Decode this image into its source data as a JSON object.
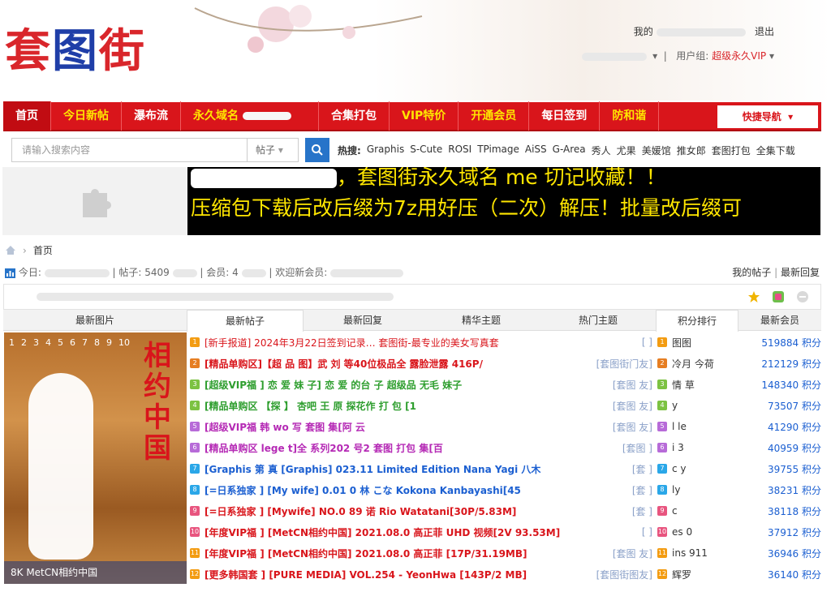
{
  "logo": {
    "c1": "套",
    "c2": "图",
    "c3": "街"
  },
  "user": {
    "my_label": "我的",
    "logout": "退出",
    "group_label": "用户组:",
    "group_value": "超级永久VIP"
  },
  "nav": {
    "items": [
      "首页",
      "今日新帖",
      "瀑布流",
      "永久域名",
      "合集打包",
      "VIP特价",
      "开通会员",
      "每日签到",
      "防和谐"
    ],
    "quick": "快捷导航"
  },
  "search": {
    "placeholder": "请输入搜索内容",
    "type": "帖子"
  },
  "hot": {
    "label": "热搜:",
    "items": [
      "Graphis",
      "S-Cute",
      "ROSI",
      "TPimage",
      "AiSS",
      "G-Area",
      "秀人",
      "尤果",
      "美媛馆",
      "推女郎",
      "套图打包",
      "全集下载"
    ]
  },
  "banner": {
    "line1": "，套图街永久域名  me 切记收藏！！",
    "line2": "压缩包下载后改后缀为7z用好压（二次）解压！批量改后缀可"
  },
  "breadcrumb": {
    "home": "首页"
  },
  "stats": {
    "today": "今日: ",
    "posts": "帖子: 5409",
    "members": "会员: 4",
    "welcome": "欢迎新会员: "
  },
  "stats_right": {
    "my_posts": "我的帖子",
    "sep": "|",
    "newest": "最新回复"
  },
  "tabs": {
    "t1": "最新图片",
    "t2": "最新帖子",
    "t3": "最新回复",
    "t4": "精华主题",
    "t5": "热门主题",
    "t6": "积分排行",
    "t7": "最新会员"
  },
  "image": {
    "pages": [
      "1",
      "2",
      "3",
      "4",
      "5",
      "6",
      "7",
      "8",
      "9",
      "10"
    ],
    "vtitle": "相约中国",
    "caption": "8K MetCN相约中国"
  },
  "threads": [
    {
      "n": "1",
      "title": "[新手报道] 2024年3月22日签到记录… 套图街-最专业的美女写真套",
      "forum": "[        ]",
      "cls": "red"
    },
    {
      "n": "2",
      "title": "[精品单购区]【超 品 图】武 刘 等40位极品全 露脸泄露 416P/",
      "forum": "[套图街门友]",
      "cls": "plain"
    },
    {
      "n": "3",
      "title": "[超级VIP福 ] 恋 爱 妹 子] 恋 爱 的台 子 超级品 无毛 妹子",
      "forum": "[套图 友]",
      "cls": "green"
    },
    {
      "n": "4",
      "title": "[精品单购区 【探 】 杏吧 王 原 探花作 打 包 [1",
      "forum": "[套图 友]",
      "cls": "green"
    },
    {
      "n": "5",
      "title": "[超级VIP福 韩 wo 写 套图 集[阿 云",
      "forum": "[套图 友]",
      "cls": "purple"
    },
    {
      "n": "6",
      "title": "[精品单购区 lege t]全 系列202 号2 套图 打包 集[百",
      "forum": "[套图 ]",
      "cls": "purple"
    },
    {
      "n": "7",
      "title": "[Graphis 第 真 [Graphis] 023.11 Limited Edition Nana Yagi 八木",
      "forum": "[套 ]",
      "cls": "blue"
    },
    {
      "n": "8",
      "title": "[=日系独家 ] [My wife] 0.01 0 林 こな Kokona Kanbayashi[45",
      "forum": "[套 ]",
      "cls": "blue"
    },
    {
      "n": "9",
      "title": "[=日系独家 ] [Mywife] NO.0 89 诺 Rio Watatani[30P/5.83M]",
      "forum": "[套 ]",
      "cls": "plain"
    },
    {
      "n": "10",
      "title": "[年度VIP福 ] [MetCN相约中国] 2021.08.0 高正菲 UHD 视频[2V 93.53M]",
      "forum": "[ ]",
      "cls": "plain"
    },
    {
      "n": "11",
      "title": "[年度VIP福 ] [MetCN相约中国] 2021.08.0 高正菲 [17P/31.19MB]",
      "forum": "[套图 友]",
      "cls": "plain"
    },
    {
      "n": "12",
      "title": "[更多韩国套 ] [PURE MEDIA] VOL.254 - YeonHwa [143P/2 MB]",
      "forum": "[套图街图友]",
      "cls": "plain"
    }
  ],
  "ranking": [
    {
      "n": "1",
      "name": "图图",
      "score": "519884 积分"
    },
    {
      "n": "2",
      "name": "冷月 今荷",
      "score": "212129 积分"
    },
    {
      "n": "3",
      "name": "情 草",
      "score": "148340 积分"
    },
    {
      "n": "4",
      "name": "y",
      "score": "73507 积分"
    },
    {
      "n": "5",
      "name": "l le",
      "score": "41290 积分"
    },
    {
      "n": "6",
      "name": "i 3",
      "score": "40959 积分"
    },
    {
      "n": "7",
      "name": "c y",
      "score": "39755 积分"
    },
    {
      "n": "8",
      "name": "ly",
      "score": "38231 积分"
    },
    {
      "n": "9",
      "name": "c",
      "score": "38118 积分"
    },
    {
      "n": "10",
      "name": "es 0",
      "score": "37912 积分"
    },
    {
      "n": "11",
      "name": "ins 911",
      "score": "36946 积分"
    },
    {
      "n": "12",
      "name": "辉罗",
      "score": "36140 积分"
    }
  ]
}
